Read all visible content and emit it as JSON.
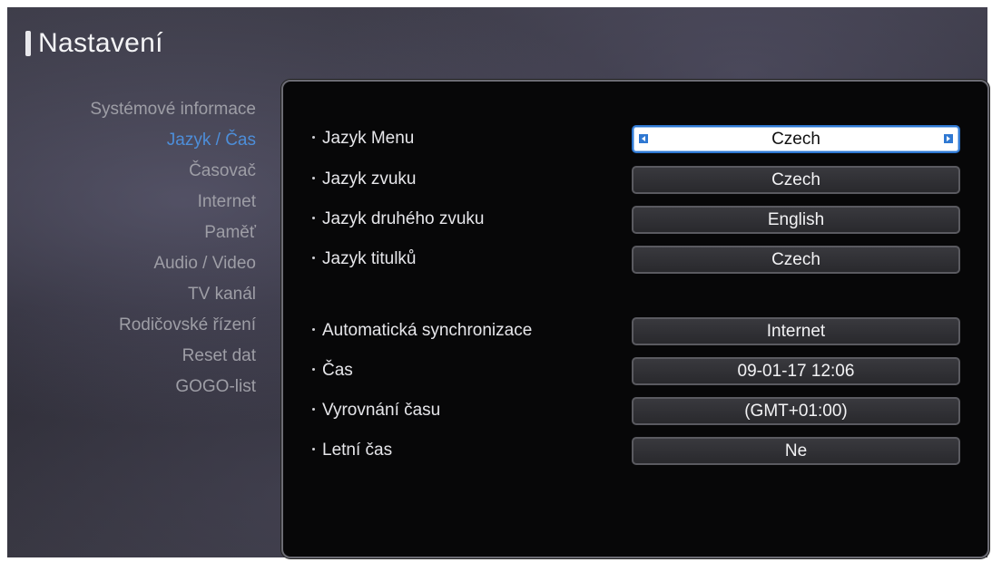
{
  "header": {
    "title": "Nastavení"
  },
  "sidebar": {
    "items": [
      {
        "label": "Systémové informace"
      },
      {
        "label": "Jazyk / Čas"
      },
      {
        "label": "Časovač"
      },
      {
        "label": "Internet"
      },
      {
        "label": "Paměť"
      },
      {
        "label": "Audio / Video"
      },
      {
        "label": "TV kanál"
      },
      {
        "label": "Rodičovské řízení"
      },
      {
        "label": "Reset dat"
      },
      {
        "label": "GOGO-list"
      }
    ],
    "active_index": 1
  },
  "settings": {
    "rows": [
      {
        "label": "Jazyk Menu",
        "value": "Czech"
      },
      {
        "label": "Jazyk zvuku",
        "value": "Czech"
      },
      {
        "label": "Jazyk druhého zvuku",
        "value": "English"
      },
      {
        "label": "Jazyk titulků",
        "value": "Czech"
      },
      {
        "label": "Automatická synchronizace",
        "value": "Internet"
      },
      {
        "label": "Čas",
        "value": "09-01-17 12:06"
      },
      {
        "label": "Vyrovnání času",
        "value": "(GMT+01:00)"
      },
      {
        "label": "Letní čas",
        "value": "Ne"
      }
    ],
    "selected_index": 0
  },
  "colors": {
    "accent": "#4d8ed9",
    "selection_border": "#2f78d2",
    "panel_background": "#070708"
  }
}
